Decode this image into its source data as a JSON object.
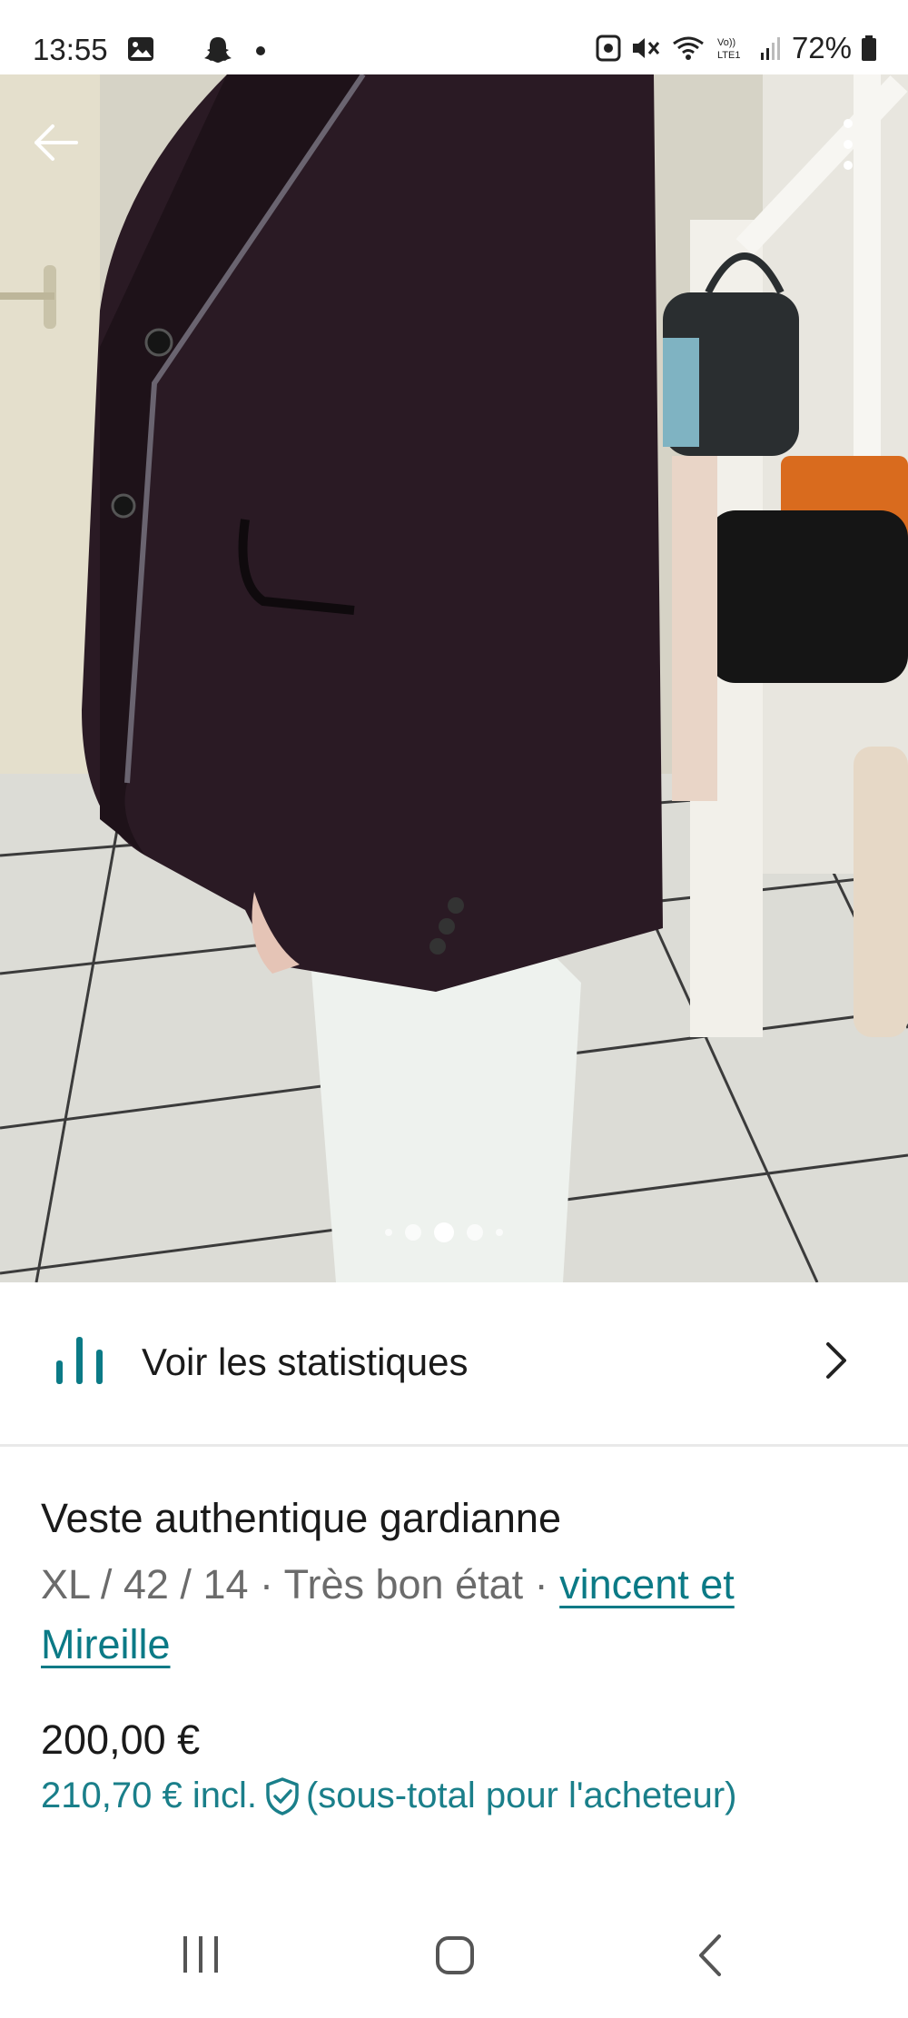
{
  "status_bar": {
    "time": "13:55",
    "battery": "72%",
    "icons": [
      "gallery-icon",
      "snapchat-icon",
      "notification-dot",
      "nfc-icon",
      "mute-icon",
      "wifi-icon",
      "volte-icon",
      "signal-icon",
      "battery-icon"
    ]
  },
  "photo": {
    "description_icon_left": "back-arrow-icon",
    "description_icon_right": "more-vert-icon",
    "pager_count": 5,
    "pager_active_index": 2
  },
  "stats": {
    "label": "Voir les statistiques",
    "icon": "bar-chart-icon"
  },
  "item": {
    "title": "Veste authentique gardianne",
    "meta_prefix": "XL / 42 / 14 · Très bon état · ",
    "brand": "vincent et Mireille",
    "price": "200,00 €",
    "price_incl_amount": "210,70 €",
    "price_incl_word": "incl.",
    "price_incl_note": "(sous-total pour l'acheteur)"
  },
  "colors": {
    "accent": "#0b7a86",
    "accent_text": "#1a7f8a",
    "secondary_text": "#6b6b6b"
  }
}
